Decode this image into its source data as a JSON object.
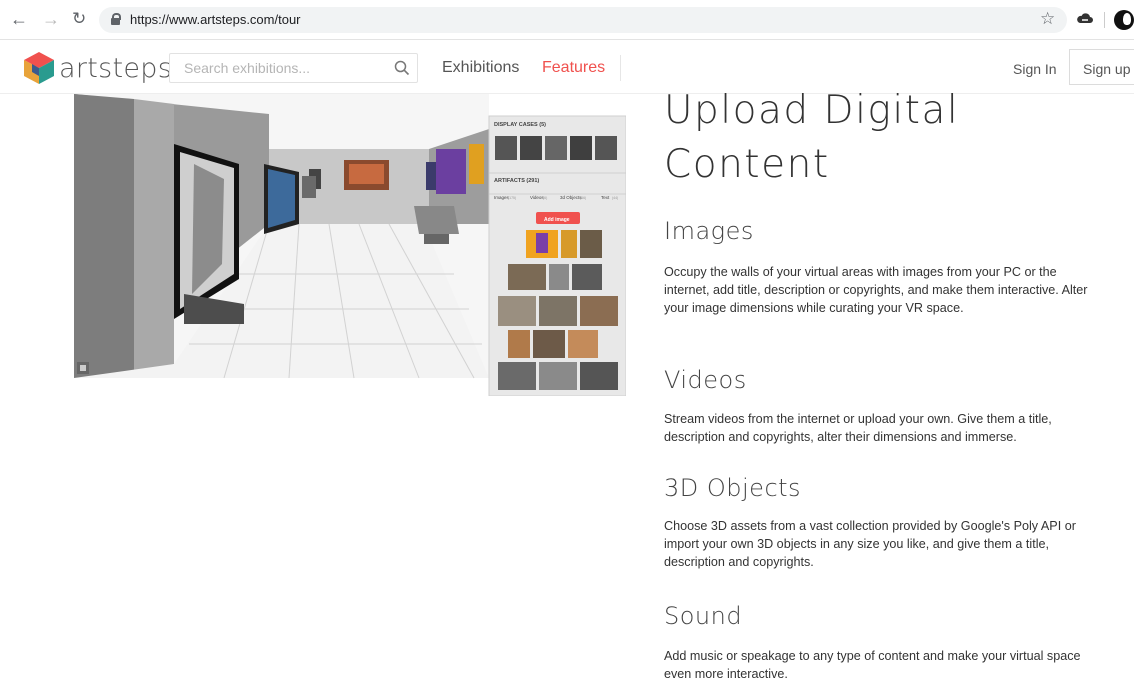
{
  "browser": {
    "url": "https://www.artsteps.com/tour",
    "icons": [
      "back-icon",
      "forward-icon",
      "reload-icon",
      "lock-icon",
      "bookmark-star-icon",
      "cloud-extension-icon",
      "profile-avatar"
    ]
  },
  "header": {
    "logo_text": "artsteps",
    "search_placeholder": "Search exhibitions...",
    "nav": {
      "exhibitions": "Exhibitions",
      "features": "Features"
    },
    "sign_in": "Sign In",
    "sign_up": "Sign up",
    "colors": {
      "accent": "#f0514e",
      "text": "#555555"
    }
  },
  "hero_panel": {
    "display_cases_label": "DISPLAY CASES (5)",
    "artifacts_label": "ARTIFACTS (291)",
    "tabs": [
      {
        "label": "Images",
        "count": "(175)"
      },
      {
        "label": "Videos",
        "count": "(6)"
      },
      {
        "label": "3d Objects",
        "count": "(66)"
      },
      {
        "label": "Text",
        "count": "(44)"
      }
    ],
    "add_button": "Add image"
  },
  "main": {
    "title_line1": "Upload Digital",
    "title_line2": "Content",
    "sections": [
      {
        "heading": "Images",
        "text": "Occupy the walls of your virtual areas with images from your PC or the internet, add title, description or copyrights, and make them interactive. Alter your image dimensions while curating your VR space."
      },
      {
        "heading": "Videos",
        "text": "Stream videos from the internet or upload your own. Give them a title, description and copyrights, alter their dimensions and immerse."
      },
      {
        "heading": "3D Objects",
        "text": "Choose 3D assets from a vast collection provided by Google's Poly API or import your own 3D objects in any size you like, and give them a title, description and copyrights."
      },
      {
        "heading": "Sound",
        "text": "Add music or speakage to any type of content and make your virtual space even more interactive."
      }
    ]
  }
}
